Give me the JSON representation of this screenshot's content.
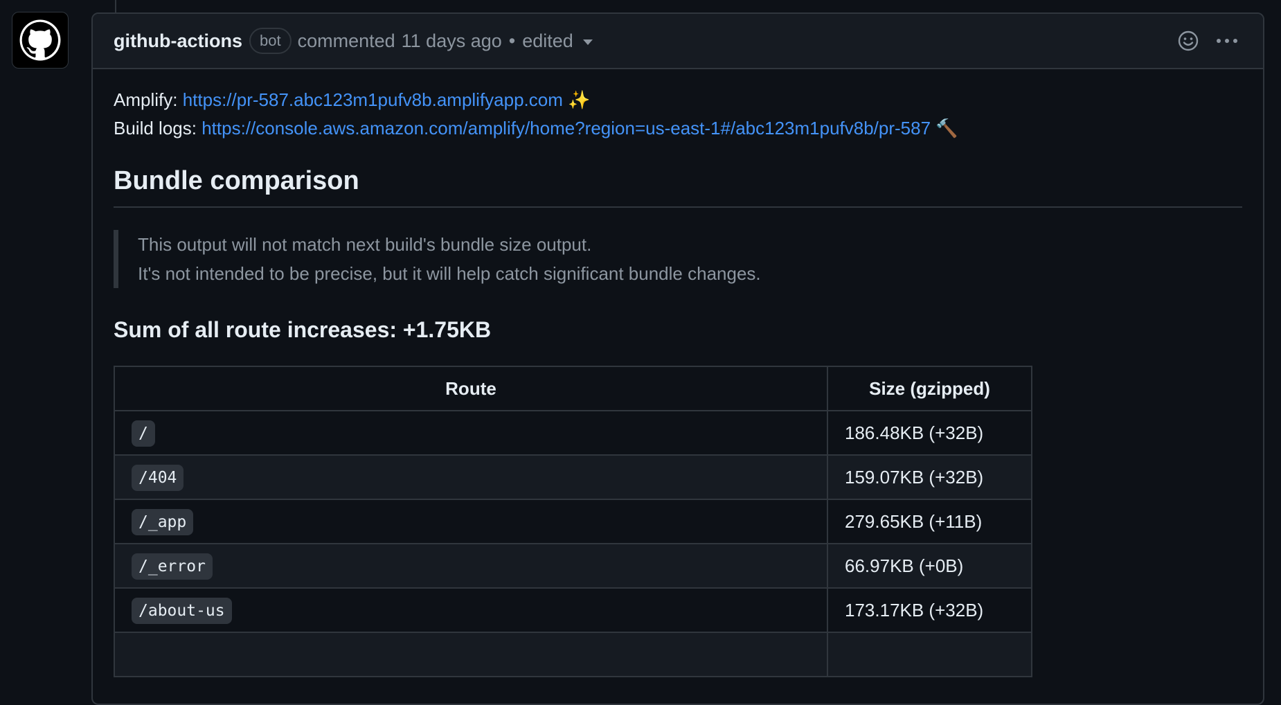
{
  "comment": {
    "author": "github-actions",
    "badge": "bot",
    "action": "commented",
    "time": "11 days ago",
    "separator": "•",
    "edited": "edited",
    "icons": {
      "avatar": "github-octocat-icon",
      "edit_caret": "chevron-down-icon",
      "reaction": "smiley-icon",
      "more": "kebab-horizontal-icon"
    }
  },
  "body": {
    "amplify_label": "Amplify:",
    "amplify_url": "https://pr-587.abc123m1pufv8b.amplifyapp.com",
    "amplify_emoji": "✨",
    "build_logs_label": "Build logs:",
    "build_logs_url": "https://console.aws.amazon.com/amplify/home?region=us-east-1#/abc123m1pufv8b/pr-587",
    "build_logs_emoji": "🔨",
    "heading": "Bundle comparison",
    "quote_line1": "This output will not match next build's bundle size output.",
    "quote_line2": "It's not intended to be precise, but it will help catch significant bundle changes.",
    "sum_heading": "Sum of all route increases: +1.75KB"
  },
  "table": {
    "headers": [
      "Route",
      "Size (gzipped)"
    ],
    "rows": [
      {
        "route": "/",
        "size": "186.48KB (+32B)"
      },
      {
        "route": "/404",
        "size": "159.07KB (+32B)"
      },
      {
        "route": "/_app",
        "size": "279.65KB (+11B)"
      },
      {
        "route": "/_error",
        "size": "66.97KB (+0B)"
      },
      {
        "route": "/about-us",
        "size": "173.17KB (+32B)"
      }
    ]
  },
  "colors": {
    "background": "#0d1117",
    "header_background": "#161b22",
    "border": "#30363d",
    "link": "#4493f8",
    "muted_text": "#8d96a0",
    "text": "#e6edf3"
  }
}
